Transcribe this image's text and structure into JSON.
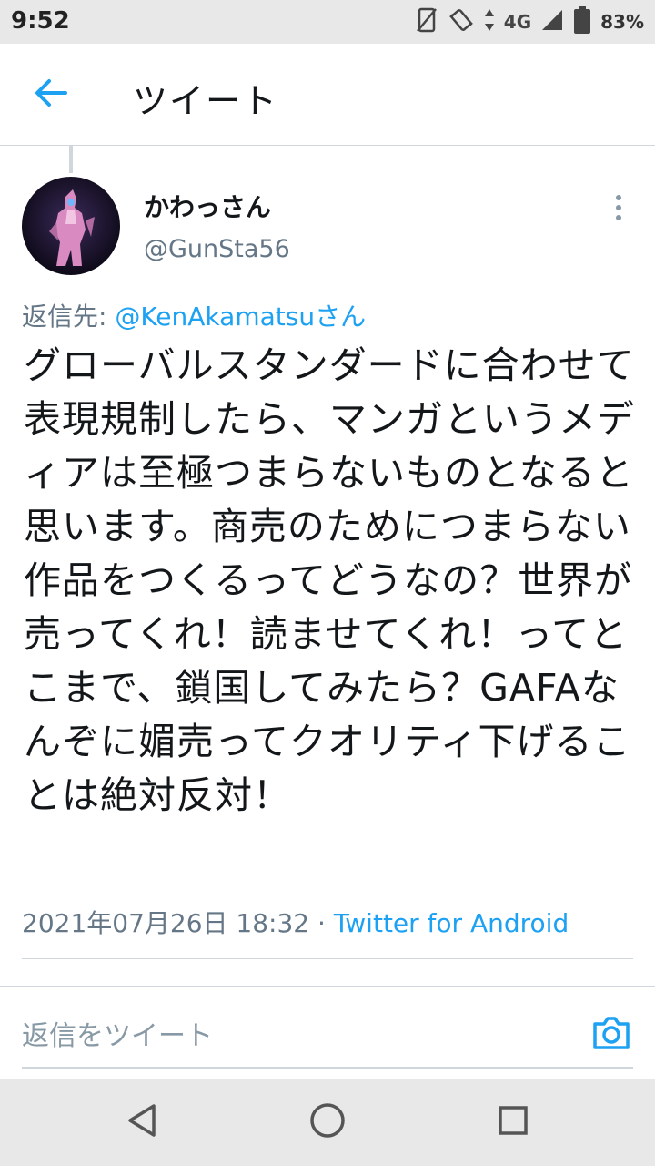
{
  "status_bar": {
    "time": "9:52",
    "network": "4G",
    "battery": "83%",
    "icons": [
      "vibrate-off-icon",
      "rotate-icon",
      "signal-icon",
      "battery-icon"
    ]
  },
  "header": {
    "title": "ツイート",
    "back_icon": "arrow-left-icon"
  },
  "tweet": {
    "author_name": "かわっさん",
    "author_handle": "@GunSta56",
    "reply_prefix": "返信先: ",
    "reply_mention": "@KenAkamatsuさん",
    "text": "グローバルスタンダードに合わせて表現規制したら、マンガというメディアは至極つまらないものとなると思います。商売のためにつまらない作品をつくるってどうなの？世界が売ってくれ！読ませてくれ！ってとこまで、鎖国してみたら？GAFAなんぞに媚売ってクオリティ下げることは絶対反対！",
    "timestamp": "2021年07月26日 18:32",
    "separator": " · ",
    "source": "Twitter for Android"
  },
  "composer": {
    "placeholder": "返信をツイート",
    "camera_icon": "camera-icon"
  },
  "nav_bar": {
    "icons": [
      "back-triangle-icon",
      "home-circle-icon",
      "recents-square-icon"
    ]
  },
  "colors": {
    "accent": "#1da1f2",
    "secondary_text": "#657786",
    "primary_text": "#14171a",
    "system_bar": "#e8e8e8"
  }
}
